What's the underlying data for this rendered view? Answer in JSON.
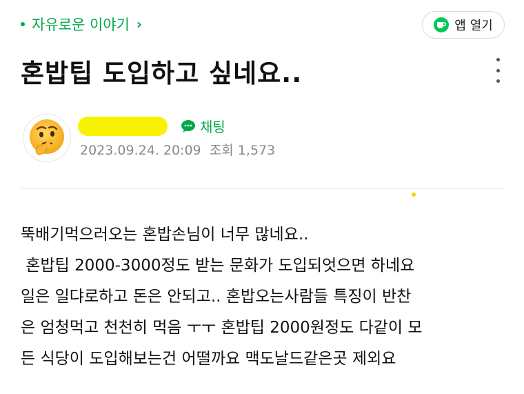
{
  "header": {
    "cafe_name": "자유로운 이야기",
    "chevron": "›",
    "app_button_label": "앱 열기",
    "more_icon": "more-vertical-icon"
  },
  "post": {
    "title": "혼밥팁 도입하고 싶네요..",
    "author": {
      "avatar_icon": "thinking-face-icon",
      "chat_label": "채팅",
      "date": "2023.09.24. 20:09",
      "views_label": "조회",
      "views": "1,573"
    },
    "body_lines": [
      "뚝배기먹으러오는 혼밥손님이 너무 많네요..",
      " 혼밥팁 2000-3000정도 받는 문화가 도입되엇으면 하네요",
      "일은 일댜로하고 돈은 안되고.. 혼밥오는사람들 특징이 반찬",
      "은 엄청먹고 천천히 먹음 ㅜㅜ 혼밥팁 2000원정도 다같이 모",
      "든 식당이 도입해보는건 어떨까요 맥도날드같은곳 제외요"
    ]
  },
  "colors": {
    "accent_green": "#03a94b",
    "redaction_yellow": "#f7f200"
  }
}
